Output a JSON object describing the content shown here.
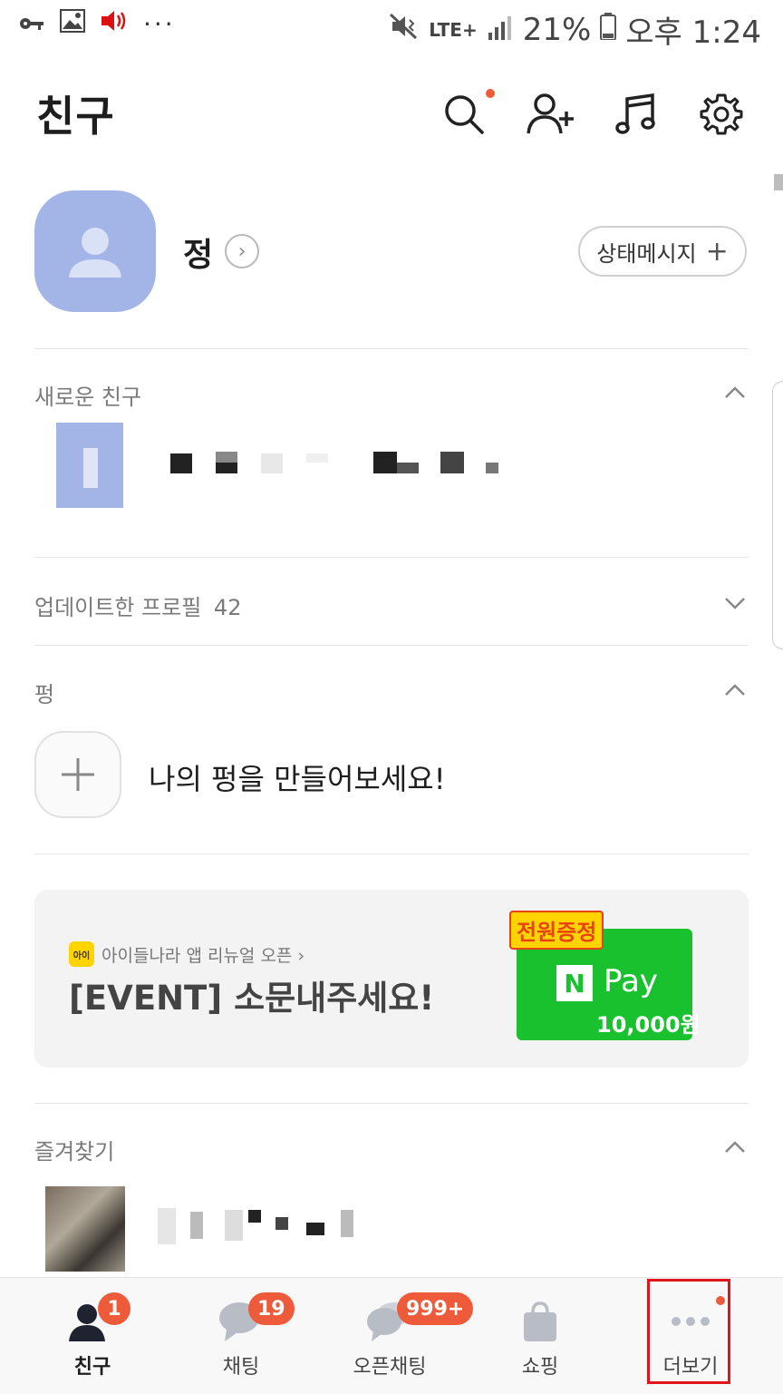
{
  "statusbar": {
    "lte": "LTE+",
    "battery": "21%",
    "time": "오후 1:24"
  },
  "header": {
    "title": "친구"
  },
  "profile": {
    "name": "정",
    "status_button": "상태메시지",
    "status_plus": "+"
  },
  "sections": {
    "new_friends": "새로운 친구",
    "updated_profiles": "업데이트한 프로필",
    "updated_count": "42",
    "ping": "펑",
    "favorites": "즐겨찾기"
  },
  "ping": {
    "prompt": "나의 펑을 만들어보세요!"
  },
  "banner": {
    "small_text": "아이들나라 앱 리뉴얼 오픈 ›",
    "logo_text": "아이",
    "title": "[EVENT] 소문내주세요!",
    "badge": "전원증정",
    "pay_n": "N",
    "pay_label": "Pay",
    "amount": "10,000원"
  },
  "nav": [
    {
      "label": "친구",
      "badge": "1"
    },
    {
      "label": "채팅",
      "badge": "19"
    },
    {
      "label": "오픈채팅",
      "badge": "999+"
    },
    {
      "label": "쇼핑",
      "badge": ""
    },
    {
      "label": "더보기",
      "badge": ""
    }
  ],
  "colors": {
    "accent": "#ee5b3b",
    "avatar": "#a3b5e6",
    "npay": "#19c12f",
    "highlight": "#e0141c"
  }
}
